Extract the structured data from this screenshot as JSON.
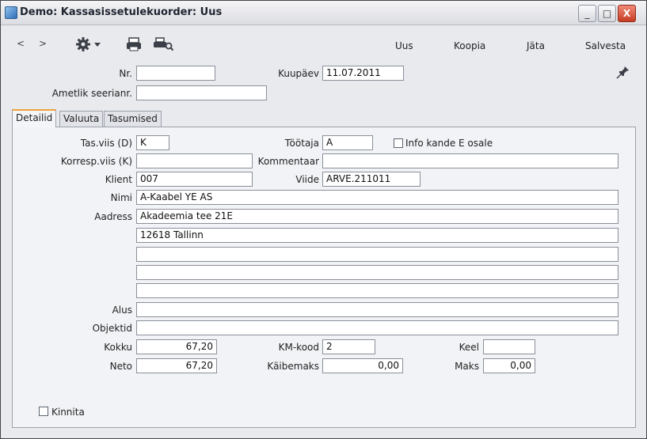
{
  "window": {
    "title": "Demo: Kassasissetulekuorder: Uus",
    "minimize_glyph": "_",
    "maximize_glyph": "□",
    "close_glyph": "X"
  },
  "toolbar": {
    "back_glyph": "<",
    "forward_glyph": ">",
    "icons": [
      "gear-icon",
      "print-icon",
      "print-preview-icon"
    ],
    "actions": [
      "Uus",
      "Koopia",
      "Jäta",
      "Salvesta"
    ]
  },
  "header": {
    "nr_label": "Nr.",
    "nr_value": "",
    "date_label": "Kuupäev",
    "date_value": "11.07.2011",
    "serial_label": "Ametlik seerianr.",
    "serial_value": "",
    "pin_icon": "pin-icon"
  },
  "tabs": [
    "Detailid",
    "Valuuta",
    "Tasumised"
  ],
  "details": {
    "payment_mode_label": "Tas.viis (D)",
    "payment_mode_value": "K",
    "employee_label": "Töötaja",
    "employee_value": "A",
    "info_label": "Info kande E osale",
    "info_checked": false,
    "corresp_label": "Korresp.viis (K)",
    "corresp_value": "",
    "comment_label": "Kommentaar",
    "comment_value": "",
    "client_label": "Klient",
    "client_value": "007",
    "ref_label": "Viide",
    "ref_value": "ARVE.211011",
    "name_label": "Nimi",
    "name_value": "A-Kaabel YE AS",
    "address_label": "Aadress",
    "address_lines": [
      "Akadeemia tee 21E",
      "12618 Tallinn",
      "",
      "",
      ""
    ],
    "basis_label": "Alus",
    "basis_value": "",
    "objects_label": "Objektid",
    "objects_value": "",
    "total_label": "Kokku",
    "total_value": "67,20",
    "vat_code_label": "KM-kood",
    "vat_code_value": "2",
    "lang_label": "Keel",
    "lang_value": "",
    "net_label": "Neto",
    "net_value": "67,20",
    "sales_tax_label": "Käibemaks",
    "sales_tax_value": "0,00",
    "tax_label": "Maks",
    "tax_value": "0,00",
    "confirm_label": "Kinnita",
    "confirm_checked": false
  }
}
